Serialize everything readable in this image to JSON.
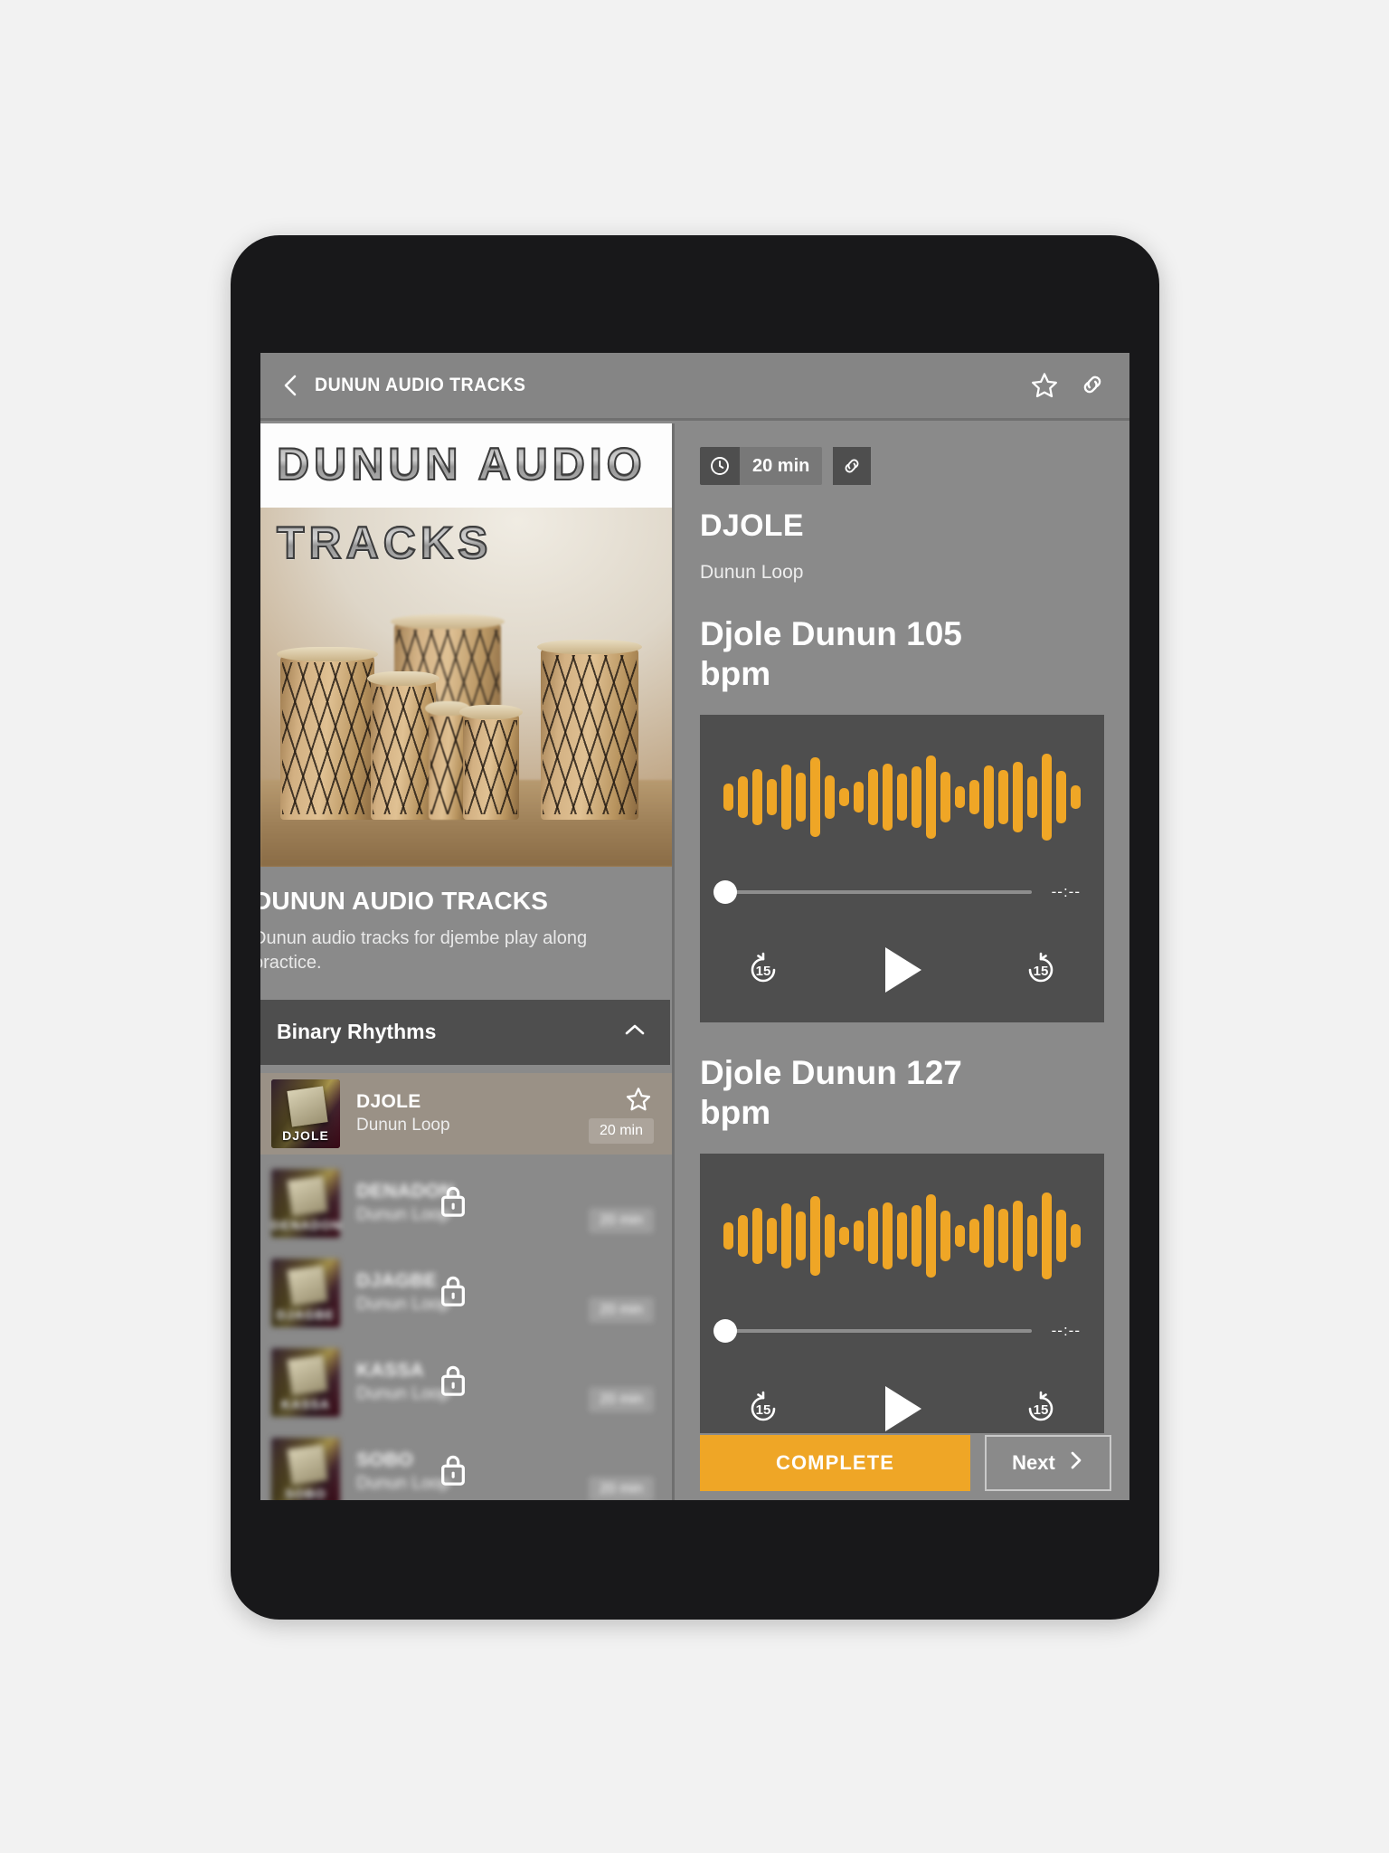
{
  "appbar": {
    "title": "DUNUN AUDIO TRACKS",
    "back_icon": "chevron-left-icon",
    "favorite_icon": "star-outline-icon",
    "share_icon": "link-icon"
  },
  "course": {
    "cover_line1": "DUNUN AUDIO",
    "cover_line2": "TRACKS",
    "title": "DUNUN AUDIO TRACKS",
    "description": "Dunun audio tracks for djembe play along practice."
  },
  "section": {
    "title": "Binary Rhythms",
    "collapse_icon": "chevron-up-icon"
  },
  "tracks": [
    {
      "name": "DJOLE",
      "subtitle": "Dunun Loop",
      "duration": "20 min",
      "thumb_label": "DJOLE",
      "locked": false,
      "active": true,
      "star_icon": "star-outline-icon"
    },
    {
      "name": "DENADON",
      "subtitle": "Dunun Loop",
      "duration": "20 min",
      "thumb_label": "DENADON",
      "locked": true,
      "active": false,
      "lock_icon": "lock-icon"
    },
    {
      "name": "DJAGBE",
      "subtitle": "Dunun Loop",
      "duration": "20 min",
      "thumb_label": "DJAGBE",
      "locked": true,
      "active": false,
      "lock_icon": "lock-icon"
    },
    {
      "name": "KASSA",
      "subtitle": "Dunun Loop",
      "duration": "20 min",
      "thumb_label": "KASSA",
      "locked": true,
      "active": false,
      "lock_icon": "lock-icon"
    },
    {
      "name": "SOBO",
      "subtitle": "Dunun Loop",
      "duration": "20 min",
      "thumb_label": "SOBO",
      "locked": true,
      "active": false,
      "lock_icon": "lock-icon"
    }
  ],
  "lesson": {
    "duration": "20 min",
    "duration_icon": "clock-icon",
    "share_icon": "link-icon",
    "title": "DJOLE",
    "subtitle": "Dunun Loop"
  },
  "players": [
    {
      "title": "Djole Dunun 105 bpm",
      "time_display": "--:--",
      "progress_percent": 0,
      "rewind_label": "15",
      "forward_label": "15",
      "rewind_icon": "replay-15-icon",
      "play_icon": "play-icon",
      "forward_icon": "forward-15-icon",
      "waveform": [
        30,
        46,
        62,
        40,
        72,
        54,
        88,
        48,
        20,
        34,
        62,
        74,
        52,
        68,
        92,
        56,
        24,
        38,
        70,
        60,
        78,
        46,
        96,
        58,
        26
      ]
    },
    {
      "title": "Djole Dunun 127 bpm",
      "time_display": "--:--",
      "progress_percent": 0,
      "rewind_label": "15",
      "forward_label": "15",
      "rewind_icon": "replay-15-icon",
      "play_icon": "play-icon",
      "forward_icon": "forward-15-icon",
      "waveform": [
        30,
        46,
        62,
        40,
        72,
        54,
        88,
        48,
        20,
        34,
        62,
        74,
        52,
        68,
        92,
        56,
        24,
        38,
        70,
        60,
        78,
        46,
        96,
        58,
        26
      ]
    }
  ],
  "footer": {
    "complete_label": "COMPLETE",
    "next_label": "Next",
    "next_icon": "chevron-right-icon"
  },
  "colors": {
    "accent": "#efa626",
    "screen_bg": "#8a8a8a",
    "panel_bg": "#4e4e4e",
    "active_row": "#9a9186"
  }
}
